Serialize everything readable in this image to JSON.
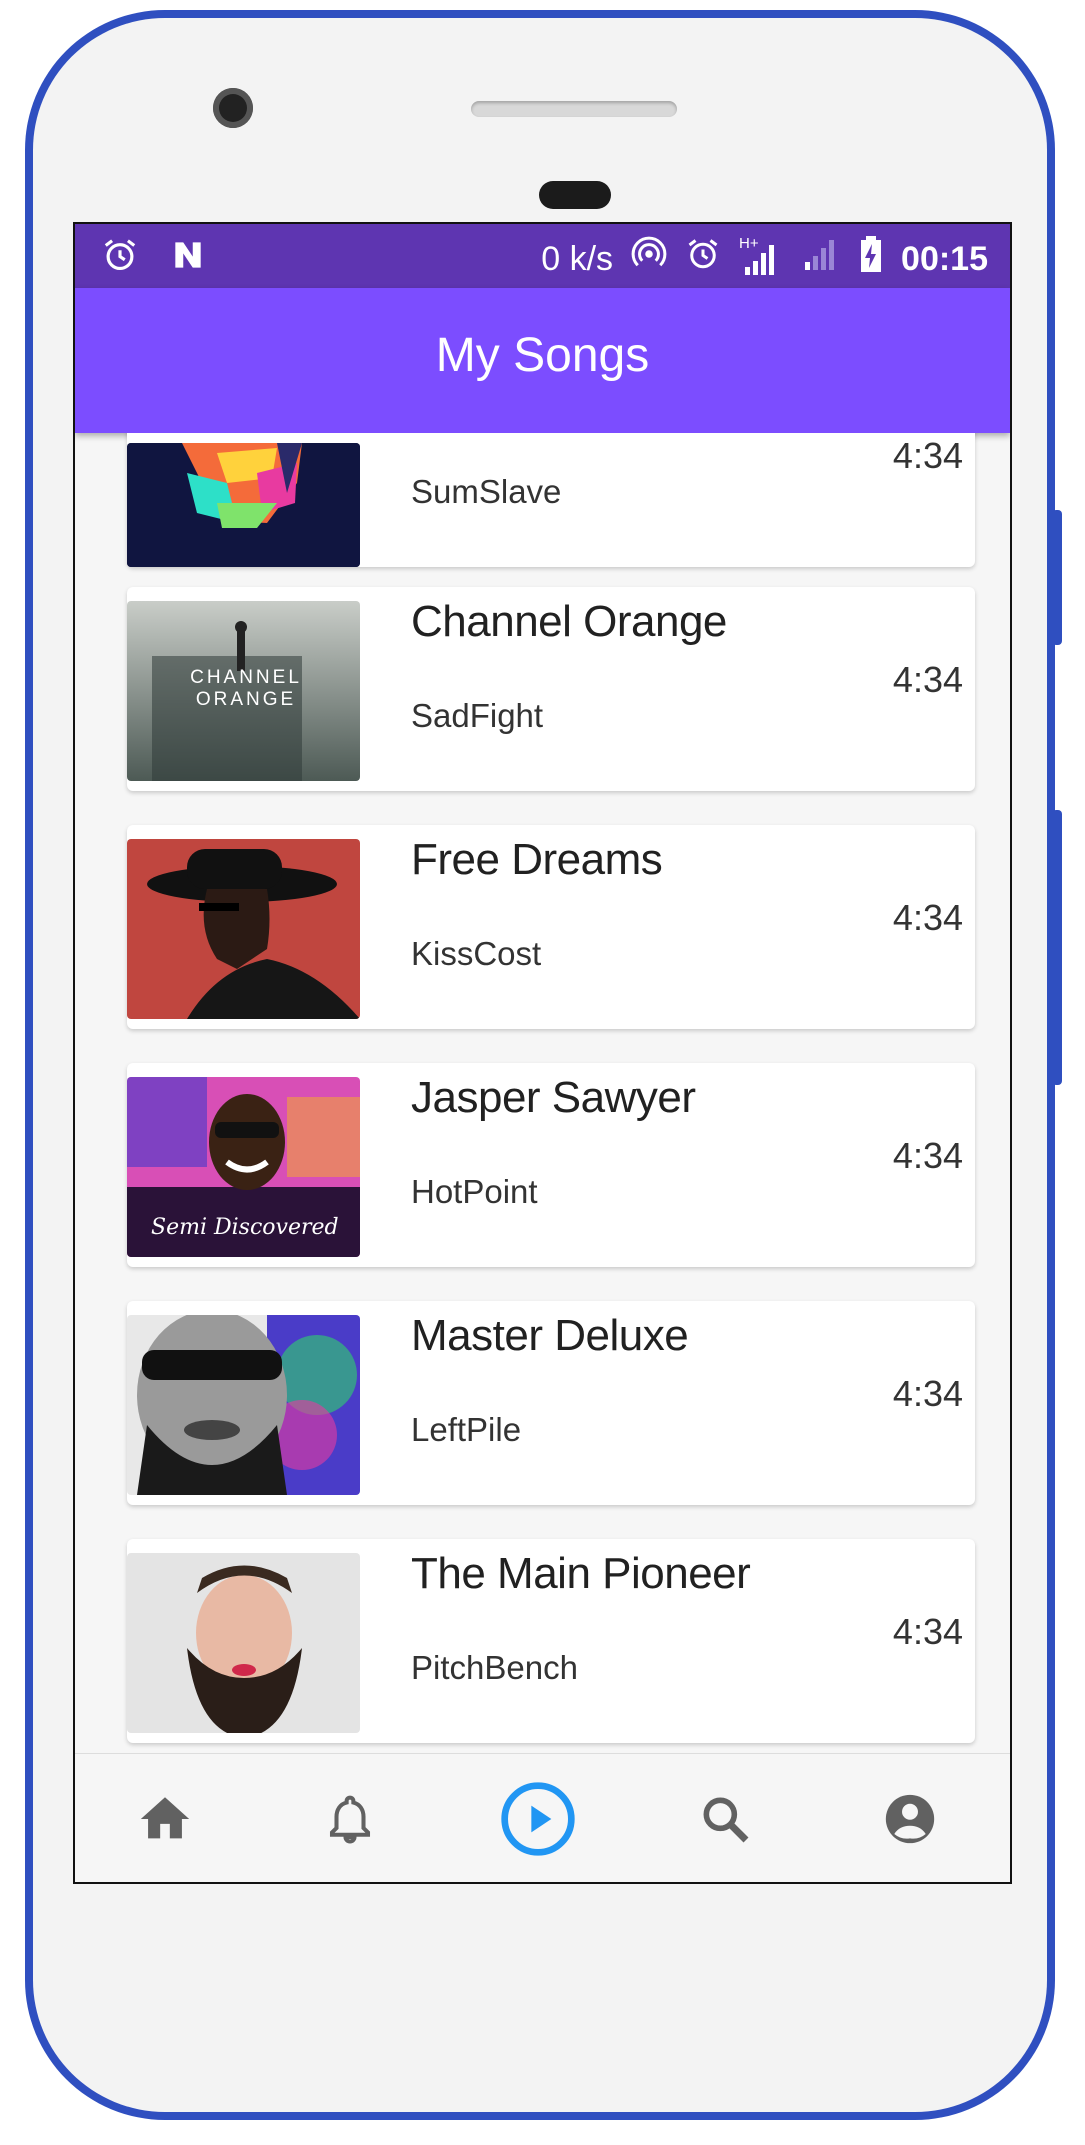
{
  "status_bar": {
    "speed": "0 k/s",
    "time": "00:15",
    "network_label": "H+"
  },
  "app_bar": {
    "title": "My Songs"
  },
  "songs": [
    {
      "title": "",
      "artist": "SumSlave",
      "duration": "4:34",
      "cover": "abstract-face-cover"
    },
    {
      "title": "Channel Orange",
      "artist": "SadFight",
      "duration": "4:34",
      "cover": "channel-orange-cover",
      "cover_text": "CHANNEL ORANGE"
    },
    {
      "title": "Free Dreams",
      "artist": "KissCost",
      "duration": "4:34",
      "cover": "man-in-hat-cover"
    },
    {
      "title": "Jasper Sawyer",
      "artist": "HotPoint",
      "duration": "4:34",
      "cover": "semi-discovered-cover",
      "cover_text": "Semi Discovered"
    },
    {
      "title": "Master Deluxe",
      "artist": "LeftPile",
      "duration": "4:34",
      "cover": "bearded-man-sunglasses-cover"
    },
    {
      "title": "The Main Pioneer",
      "artist": "PitchBench",
      "duration": "4:34",
      "cover": "bearded-man-portrait-cover"
    }
  ],
  "bottom_nav": [
    {
      "icon": "home-icon",
      "active": false
    },
    {
      "icon": "bell-icon",
      "active": false
    },
    {
      "icon": "play-circle-icon",
      "active": true
    },
    {
      "icon": "search-icon",
      "active": false
    },
    {
      "icon": "account-circle-icon",
      "active": false
    }
  ],
  "colors": {
    "status_bar": "#5e35b1",
    "app_bar": "#7c4dff",
    "nav_active": "#2196f3",
    "nav_inactive": "#616161",
    "phone_frame": "#2f4fc0"
  }
}
